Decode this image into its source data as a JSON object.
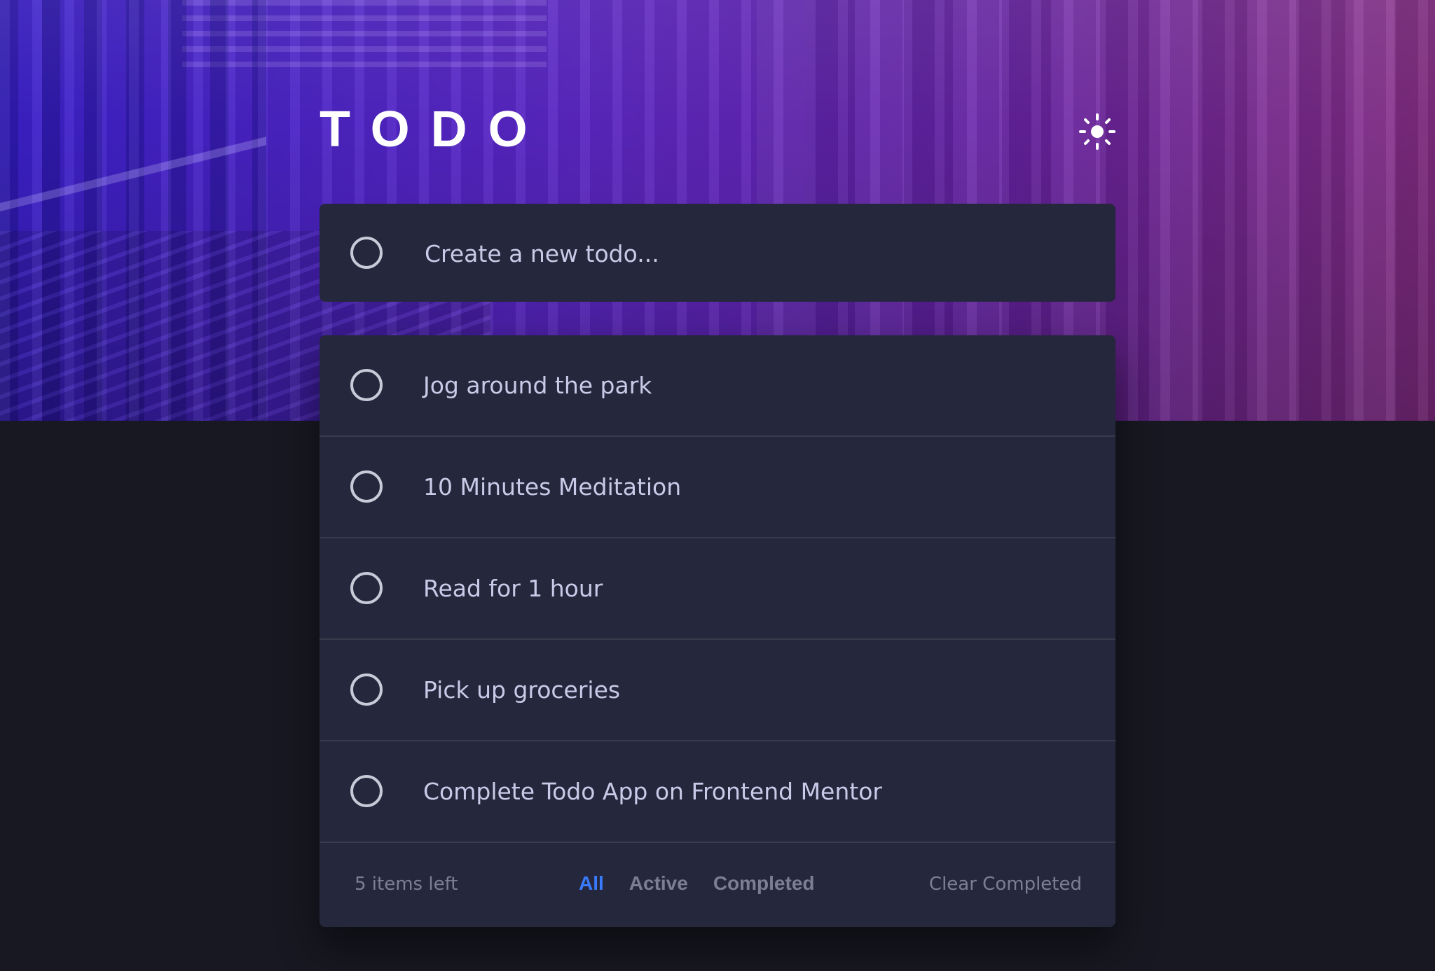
{
  "header": {
    "title": "TODO",
    "theme_icon": "sun-icon"
  },
  "new_todo": {
    "placeholder": "Create a new todo..."
  },
  "todos": [
    {
      "text": "Jog around the park",
      "completed": false
    },
    {
      "text": "10 Minutes Meditation",
      "completed": false
    },
    {
      "text": "Read for 1 hour",
      "completed": false
    },
    {
      "text": "Pick up groceries",
      "completed": false
    },
    {
      "text": "Complete Todo App on Frontend Mentor",
      "completed": false
    }
  ],
  "footer": {
    "items_left": "5 items left",
    "filters": [
      "All",
      "Active",
      "Completed"
    ],
    "active_filter": "All",
    "clear_label": "Clear Completed"
  },
  "colors": {
    "background": "#171821",
    "card": "#25273d",
    "text": "#c8cbe7",
    "muted": "#7d7e94",
    "accent": "#3a7bfd",
    "divider": "#393a4c",
    "hero_start": "#3b20c9",
    "hero_end": "#862d86"
  }
}
